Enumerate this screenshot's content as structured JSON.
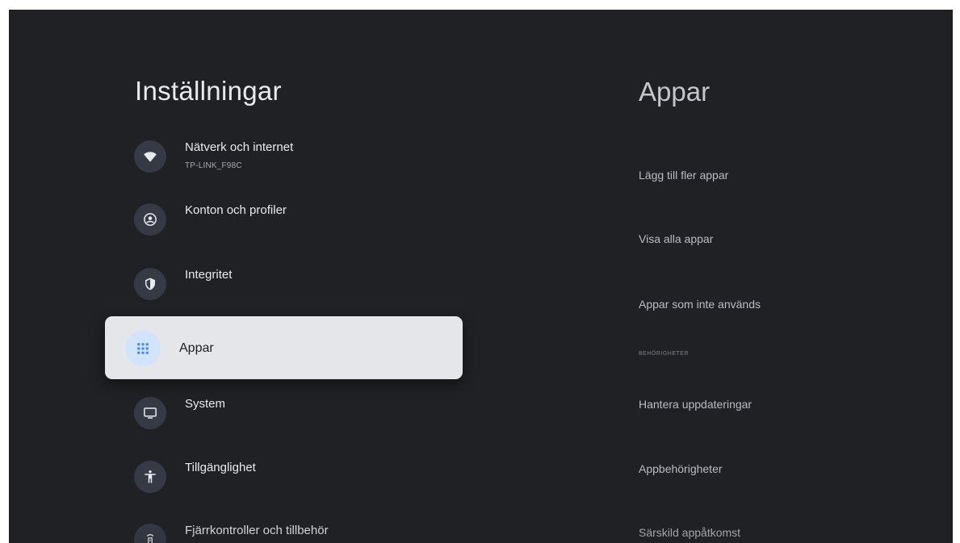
{
  "settings": {
    "title": "Inställningar",
    "items": [
      {
        "label": "Nätverk och internet",
        "sublabel": "TP-LINK_F98C",
        "icon": "wifi-icon"
      },
      {
        "label": "Konton och profiler",
        "icon": "account-circle-icon"
      },
      {
        "label": "Integritet",
        "icon": "shield-icon"
      },
      {
        "label": "Appar",
        "icon": "apps-grid-icon",
        "selected": true
      },
      {
        "label": "System",
        "icon": "tv-monitor-icon"
      },
      {
        "label": "Tillgänglighet",
        "icon": "accessibility-icon"
      },
      {
        "label": "Fjärrkontroller och tillbehör",
        "icon": "remote-control-icon"
      }
    ]
  },
  "apps_panel": {
    "title": "Appar",
    "items": [
      "Lägg till fler appar",
      "Visa alla appar",
      "Appar som inte används"
    ],
    "section_header": "BEHÖRIGHETER",
    "permission_items": [
      "Hantera uppdateringar",
      "Appbehörigheter",
      "Särskild appåtkomst"
    ]
  },
  "colors": {
    "background": "#202124",
    "icon_circle": "#353a45",
    "selected_card": "#e4e6ea",
    "accent_blue": "#4285f4"
  }
}
